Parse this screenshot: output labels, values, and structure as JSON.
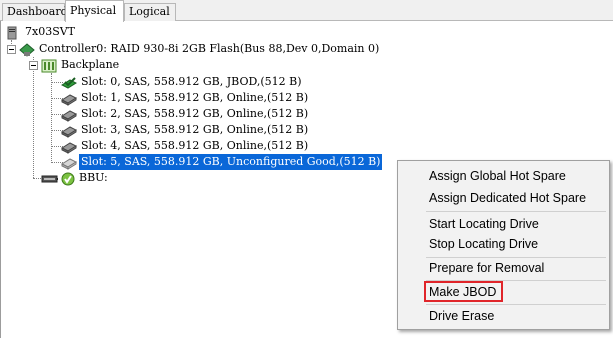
{
  "tabs": [
    {
      "label": "Dashboard"
    },
    {
      "label": "Physical"
    },
    {
      "label": "Logical"
    }
  ],
  "tree": {
    "root": "7x03SVT",
    "controller": "Controller0: RAID 930-8i 2GB Flash(Bus 88,Dev 0,Domain 0)",
    "backplane": "Backplane",
    "slots": [
      "Slot: 0, SAS, 558.912 GB, JBOD,(512 B)",
      "Slot: 1, SAS, 558.912 GB, Online,(512 B)",
      "Slot: 2, SAS, 558.912 GB, Online,(512 B)",
      "Slot: 3, SAS, 558.912 GB, Online,(512 B)",
      "Slot: 4, SAS, 558.912 GB, Online,(512 B)",
      "Slot: 5, SAS, 558.912 GB, Unconfigured Good,(512 B)"
    ],
    "bbu": "BBU:"
  },
  "context_menu": {
    "items": [
      "Assign Global Hot Spare",
      "Assign Dedicated Hot Spare",
      "Start Locating Drive",
      "Stop Locating Drive",
      "Prepare for Removal",
      "Make JBOD",
      "Drive Erase"
    ],
    "highlight_color": "#e0252a"
  },
  "colors": {
    "selection": "#0a67d8",
    "jbod_icon": "#2e9d3a"
  }
}
